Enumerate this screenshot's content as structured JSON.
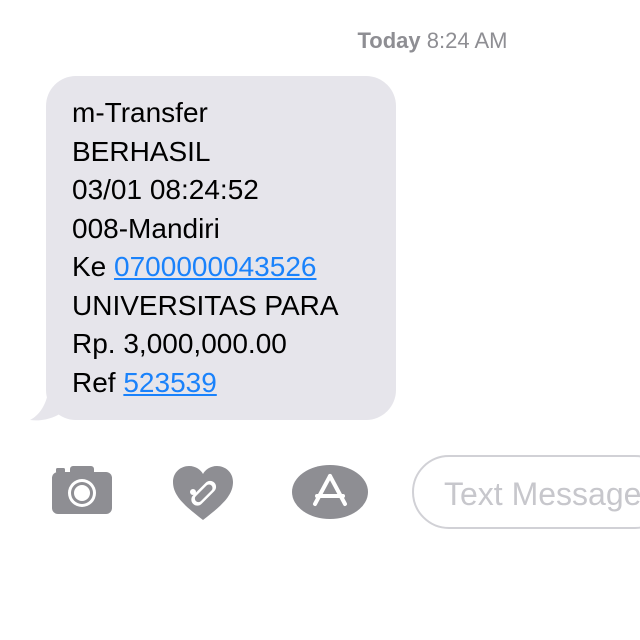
{
  "timestamp": {
    "day": "Today",
    "time": "8:24 AM"
  },
  "message": {
    "lines": [
      {
        "text": "m-Transfer"
      },
      {
        "text": "BERHASIL"
      },
      {
        "text": "03/01 08:24:52"
      },
      {
        "text": "008-Mandiri"
      },
      {
        "prefix": "Ke ",
        "link": "0700000043526"
      },
      {
        "text": "UNIVERSITAS PARA"
      },
      {
        "text": "Rp. 3,000,000.00"
      },
      {
        "prefix": "Ref ",
        "link": "523539"
      }
    ]
  },
  "composer": {
    "placeholder": "Text Message",
    "icons": [
      "camera-icon",
      "digital-touch-heart-icon",
      "app-store-icon"
    ]
  },
  "colors": {
    "bubble": "#e6e5eb",
    "link": "#1a82fb",
    "icon": "#8e8e93",
    "timestamp": "#8e8e93"
  }
}
